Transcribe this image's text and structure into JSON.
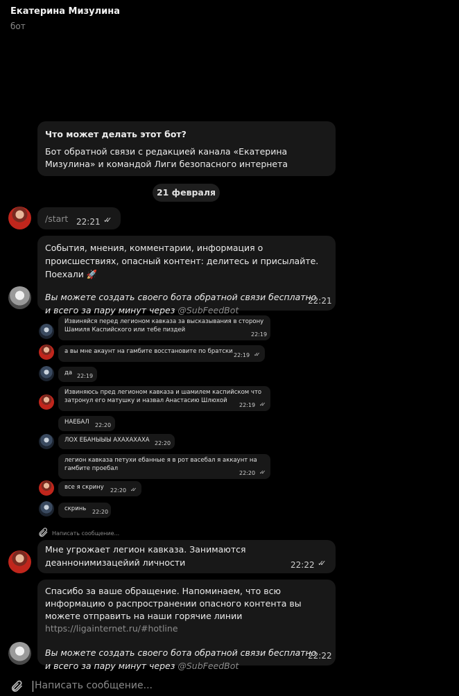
{
  "header": {
    "title": "Екатерина Мизулина",
    "subtitle": "бот"
  },
  "bot_info": {
    "heading": "Что может делать этот бот?",
    "body": "Бот обратной связи с редакцией канала «Екатерина Мизулина» и командой Лиги безопасного интернета"
  },
  "date_separator": "21 февраля",
  "messages": {
    "start": {
      "text": "/start",
      "time": "22:21"
    },
    "welcome": {
      "line1": "События, мнения, комментарии, информация о происшествиях, опасный контент: делитесь и присылайте. Поехали 🚀",
      "line2": "Вы можете создать своего бота обратной связи бесплатно и всего за пару минут через ",
      "mention": "@SubFeedBot",
      "time": "22:21"
    },
    "threat": {
      "text": "Мне угрожает легион кавказа. Занимаются деаннонимизацейий личности",
      "time": "22:22"
    },
    "thanks": {
      "line1": "Спасибо за ваше обращение. Напоминаем, что всю информацию о распространении опасного контента вы можете отправить на наши горячие линии ",
      "link": "https://ligainternet.ru/#hotline",
      "line2": "Вы можете создать своего бота обратной связи бесплатно и всего за пару минут через ",
      "mention": "@SubFeedBot",
      "time": "22:22"
    }
  },
  "embedded": [
    {
      "text": "Извиняйся перед легионом кавказа за высказывания в сторону Шамиля Каспийского или тебе пиздей",
      "time": "22:19"
    },
    {
      "text": "а вы мне акаунт на гамбите восстановите по братски",
      "time": "22:19"
    },
    {
      "text": "да",
      "time": "22:19"
    },
    {
      "text": "Извиняюсь пред легионом кавказа и шамилем каспийском что затронул его матушку и назвал Анастасию Шлюхой",
      "time": "22:19"
    },
    {
      "text": "НАЕБАЛ",
      "time": "22:20"
    },
    {
      "text": "ЛОХ ЕБАНЫЫЫ АХАХАХАХА",
      "time": "22:20"
    },
    {
      "text": "легион кавказа петухи ебанные я в рот васебал я аккаунт на гамбите проебал",
      "time": "22:20"
    },
    {
      "text": "все я скрину",
      "time": "22:20"
    },
    {
      "text": "скринь",
      "time": "22:20"
    }
  ],
  "embedded_input_placeholder": "Написать сообщение...",
  "input": {
    "placeholder": "Написать сообщение..."
  },
  "colors": {
    "background": "#000000",
    "bubble": "#181818",
    "muted": "#8d8d8d"
  }
}
